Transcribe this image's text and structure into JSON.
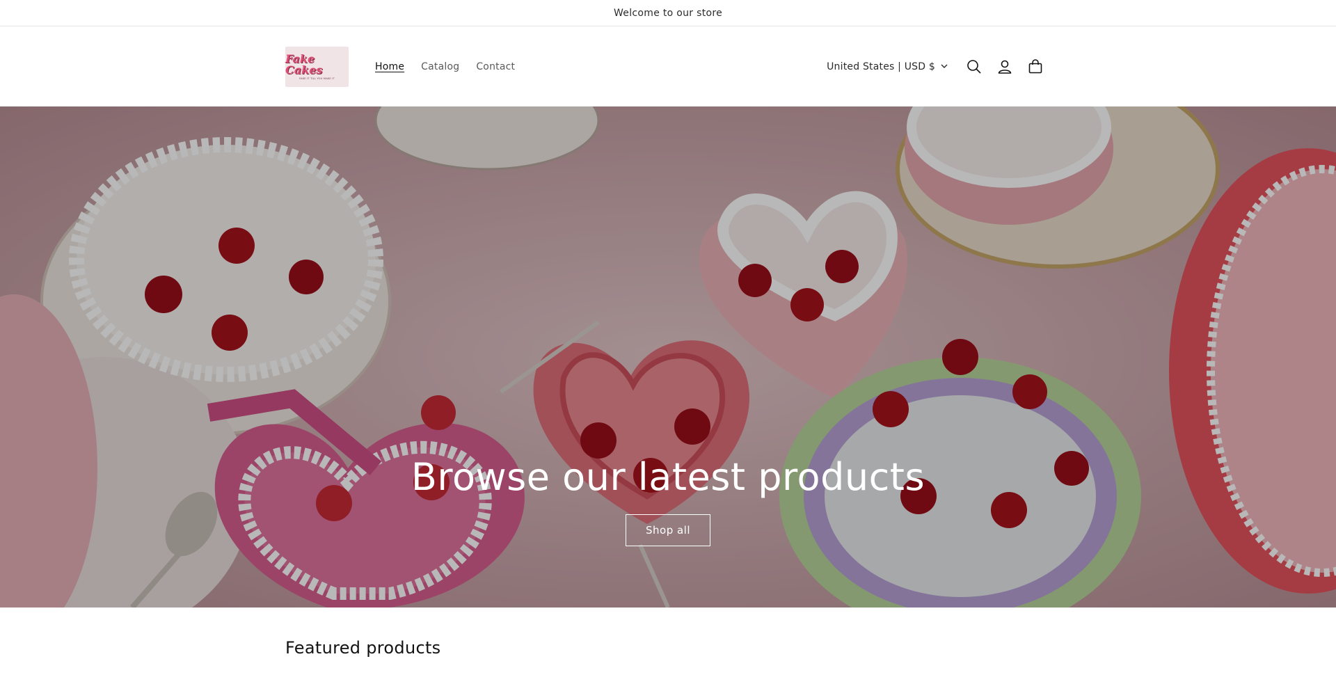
{
  "announcement": {
    "text": "Welcome to our store"
  },
  "header": {
    "logo": {
      "text": "Fake Cakes",
      "tagline": "FAKE IT TILL YOU MAKE IT"
    },
    "nav": [
      {
        "label": "Home",
        "active": true
      },
      {
        "label": "Catalog",
        "active": false
      },
      {
        "label": "Contact",
        "active": false
      }
    ],
    "country_selector": {
      "label": "United States | USD $",
      "icon": "chevron-down-icon"
    },
    "icons": [
      "search-icon",
      "account-icon",
      "cart-icon"
    ]
  },
  "hero": {
    "title": "Browse our latest products",
    "button_label": "Shop all"
  },
  "featured": {
    "heading": "Featured products"
  },
  "colors": {
    "text": "#121212",
    "hero_button_border": "#ffffff",
    "logo_pink": "#e04f78"
  }
}
